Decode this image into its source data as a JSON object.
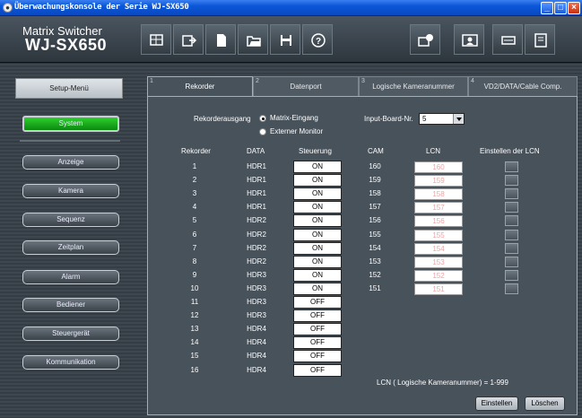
{
  "window": {
    "title": "Überwachungskonsole der Serie WJ-SX650"
  },
  "brand": {
    "line1": "Matrix Switcher",
    "line2": "WJ-SX650"
  },
  "toolbar": {
    "buttons": [
      "grid-icon",
      "export-icon",
      "new-file-icon",
      "open-folder-icon",
      "save-icon",
      "help-icon",
      "info-camera-icon",
      "user-icon",
      "network-icon",
      "monitor-icon"
    ]
  },
  "sidebar": {
    "title": "Setup-Menü",
    "items": [
      "System",
      "Anzeige",
      "Kamera",
      "Sequenz",
      "Zeitplan",
      "Alarm",
      "Bediener",
      "Steuergerät",
      "Kommunikation"
    ],
    "active": "System"
  },
  "tabs": [
    {
      "num": "1",
      "label": "Rekorder"
    },
    {
      "num": "2",
      "label": "Datenport"
    },
    {
      "num": "3",
      "label": "Logische Kameranummer"
    },
    {
      "num": "4",
      "label": "VD2/DATA/Cable Comp."
    }
  ],
  "form": {
    "output_label": "Rekorderausgang",
    "option_matrix": "Matrix-Eingang",
    "option_external": "Externer Monitor",
    "selected_output": "Matrix-Eingang",
    "board_label": "Input-Board-Nr.",
    "board_value": "5"
  },
  "table": {
    "headers": {
      "rekorder": "Rekorder",
      "data": "DATA",
      "steuerung": "Steuerung",
      "cam": "CAM",
      "lcn": "LCN",
      "set_lcn": "Einstellen der LCN"
    },
    "rows": [
      {
        "rekorder": "1",
        "data": "HDR1",
        "steuerung": "ON",
        "cam": "160",
        "lcn": "160"
      },
      {
        "rekorder": "2",
        "data": "HDR1",
        "steuerung": "ON",
        "cam": "159",
        "lcn": "159"
      },
      {
        "rekorder": "3",
        "data": "HDR1",
        "steuerung": "ON",
        "cam": "158",
        "lcn": "158"
      },
      {
        "rekorder": "4",
        "data": "HDR1",
        "steuerung": "ON",
        "cam": "157",
        "lcn": "157"
      },
      {
        "rekorder": "5",
        "data": "HDR2",
        "steuerung": "ON",
        "cam": "156",
        "lcn": "156"
      },
      {
        "rekorder": "6",
        "data": "HDR2",
        "steuerung": "ON",
        "cam": "155",
        "lcn": "155"
      },
      {
        "rekorder": "7",
        "data": "HDR2",
        "steuerung": "ON",
        "cam": "154",
        "lcn": "154"
      },
      {
        "rekorder": "8",
        "data": "HDR2",
        "steuerung": "ON",
        "cam": "153",
        "lcn": "153"
      },
      {
        "rekorder": "9",
        "data": "HDR3",
        "steuerung": "ON",
        "cam": "152",
        "lcn": "152"
      },
      {
        "rekorder": "10",
        "data": "HDR3",
        "steuerung": "ON",
        "cam": "151",
        "lcn": "151"
      },
      {
        "rekorder": "11",
        "data": "HDR3",
        "steuerung": "OFF"
      },
      {
        "rekorder": "12",
        "data": "HDR3",
        "steuerung": "OFF"
      },
      {
        "rekorder": "13",
        "data": "HDR4",
        "steuerung": "OFF"
      },
      {
        "rekorder": "14",
        "data": "HDR4",
        "steuerung": "OFF"
      },
      {
        "rekorder": "15",
        "data": "HDR4",
        "steuerung": "OFF"
      },
      {
        "rekorder": "16",
        "data": "HDR4",
        "steuerung": "OFF"
      }
    ]
  },
  "footer": {
    "note": "LCN ( Logische Kameranummer) = 1-999",
    "set_button": "Einstellen",
    "delete_button": "Löschen"
  },
  "colors": {
    "active_green": "#1aa81a",
    "titlebar_blue": "#0b56d8",
    "panel": "#48525b"
  }
}
